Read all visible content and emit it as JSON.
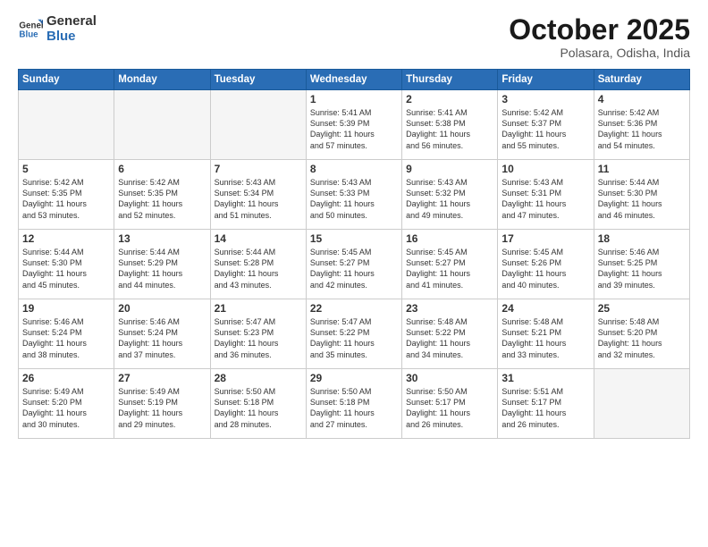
{
  "header": {
    "logo_general": "General",
    "logo_blue": "Blue",
    "month_title": "October 2025",
    "subtitle": "Polasara, Odisha, India"
  },
  "weekdays": [
    "Sunday",
    "Monday",
    "Tuesday",
    "Wednesday",
    "Thursday",
    "Friday",
    "Saturday"
  ],
  "weeks": [
    [
      {
        "day": "",
        "empty": true
      },
      {
        "day": "",
        "empty": true
      },
      {
        "day": "",
        "empty": true
      },
      {
        "day": "1",
        "line1": "Sunrise: 5:41 AM",
        "line2": "Sunset: 5:39 PM",
        "line3": "Daylight: 11 hours",
        "line4": "and 57 minutes."
      },
      {
        "day": "2",
        "line1": "Sunrise: 5:41 AM",
        "line2": "Sunset: 5:38 PM",
        "line3": "Daylight: 11 hours",
        "line4": "and 56 minutes."
      },
      {
        "day": "3",
        "line1": "Sunrise: 5:42 AM",
        "line2": "Sunset: 5:37 PM",
        "line3": "Daylight: 11 hours",
        "line4": "and 55 minutes."
      },
      {
        "day": "4",
        "line1": "Sunrise: 5:42 AM",
        "line2": "Sunset: 5:36 PM",
        "line3": "Daylight: 11 hours",
        "line4": "and 54 minutes."
      }
    ],
    [
      {
        "day": "5",
        "line1": "Sunrise: 5:42 AM",
        "line2": "Sunset: 5:35 PM",
        "line3": "Daylight: 11 hours",
        "line4": "and 53 minutes."
      },
      {
        "day": "6",
        "line1": "Sunrise: 5:42 AM",
        "line2": "Sunset: 5:35 PM",
        "line3": "Daylight: 11 hours",
        "line4": "and 52 minutes."
      },
      {
        "day": "7",
        "line1": "Sunrise: 5:43 AM",
        "line2": "Sunset: 5:34 PM",
        "line3": "Daylight: 11 hours",
        "line4": "and 51 minutes."
      },
      {
        "day": "8",
        "line1": "Sunrise: 5:43 AM",
        "line2": "Sunset: 5:33 PM",
        "line3": "Daylight: 11 hours",
        "line4": "and 50 minutes."
      },
      {
        "day": "9",
        "line1": "Sunrise: 5:43 AM",
        "line2": "Sunset: 5:32 PM",
        "line3": "Daylight: 11 hours",
        "line4": "and 49 minutes."
      },
      {
        "day": "10",
        "line1": "Sunrise: 5:43 AM",
        "line2": "Sunset: 5:31 PM",
        "line3": "Daylight: 11 hours",
        "line4": "and 47 minutes."
      },
      {
        "day": "11",
        "line1": "Sunrise: 5:44 AM",
        "line2": "Sunset: 5:30 PM",
        "line3": "Daylight: 11 hours",
        "line4": "and 46 minutes."
      }
    ],
    [
      {
        "day": "12",
        "line1": "Sunrise: 5:44 AM",
        "line2": "Sunset: 5:30 PM",
        "line3": "Daylight: 11 hours",
        "line4": "and 45 minutes."
      },
      {
        "day": "13",
        "line1": "Sunrise: 5:44 AM",
        "line2": "Sunset: 5:29 PM",
        "line3": "Daylight: 11 hours",
        "line4": "and 44 minutes."
      },
      {
        "day": "14",
        "line1": "Sunrise: 5:44 AM",
        "line2": "Sunset: 5:28 PM",
        "line3": "Daylight: 11 hours",
        "line4": "and 43 minutes."
      },
      {
        "day": "15",
        "line1": "Sunrise: 5:45 AM",
        "line2": "Sunset: 5:27 PM",
        "line3": "Daylight: 11 hours",
        "line4": "and 42 minutes."
      },
      {
        "day": "16",
        "line1": "Sunrise: 5:45 AM",
        "line2": "Sunset: 5:27 PM",
        "line3": "Daylight: 11 hours",
        "line4": "and 41 minutes."
      },
      {
        "day": "17",
        "line1": "Sunrise: 5:45 AM",
        "line2": "Sunset: 5:26 PM",
        "line3": "Daylight: 11 hours",
        "line4": "and 40 minutes."
      },
      {
        "day": "18",
        "line1": "Sunrise: 5:46 AM",
        "line2": "Sunset: 5:25 PM",
        "line3": "Daylight: 11 hours",
        "line4": "and 39 minutes."
      }
    ],
    [
      {
        "day": "19",
        "line1": "Sunrise: 5:46 AM",
        "line2": "Sunset: 5:24 PM",
        "line3": "Daylight: 11 hours",
        "line4": "and 38 minutes."
      },
      {
        "day": "20",
        "line1": "Sunrise: 5:46 AM",
        "line2": "Sunset: 5:24 PM",
        "line3": "Daylight: 11 hours",
        "line4": "and 37 minutes."
      },
      {
        "day": "21",
        "line1": "Sunrise: 5:47 AM",
        "line2": "Sunset: 5:23 PM",
        "line3": "Daylight: 11 hours",
        "line4": "and 36 minutes."
      },
      {
        "day": "22",
        "line1": "Sunrise: 5:47 AM",
        "line2": "Sunset: 5:22 PM",
        "line3": "Daylight: 11 hours",
        "line4": "and 35 minutes."
      },
      {
        "day": "23",
        "line1": "Sunrise: 5:48 AM",
        "line2": "Sunset: 5:22 PM",
        "line3": "Daylight: 11 hours",
        "line4": "and 34 minutes."
      },
      {
        "day": "24",
        "line1": "Sunrise: 5:48 AM",
        "line2": "Sunset: 5:21 PM",
        "line3": "Daylight: 11 hours",
        "line4": "and 33 minutes."
      },
      {
        "day": "25",
        "line1": "Sunrise: 5:48 AM",
        "line2": "Sunset: 5:20 PM",
        "line3": "Daylight: 11 hours",
        "line4": "and 32 minutes."
      }
    ],
    [
      {
        "day": "26",
        "line1": "Sunrise: 5:49 AM",
        "line2": "Sunset: 5:20 PM",
        "line3": "Daylight: 11 hours",
        "line4": "and 30 minutes."
      },
      {
        "day": "27",
        "line1": "Sunrise: 5:49 AM",
        "line2": "Sunset: 5:19 PM",
        "line3": "Daylight: 11 hours",
        "line4": "and 29 minutes."
      },
      {
        "day": "28",
        "line1": "Sunrise: 5:50 AM",
        "line2": "Sunset: 5:18 PM",
        "line3": "Daylight: 11 hours",
        "line4": "and 28 minutes."
      },
      {
        "day": "29",
        "line1": "Sunrise: 5:50 AM",
        "line2": "Sunset: 5:18 PM",
        "line3": "Daylight: 11 hours",
        "line4": "and 27 minutes."
      },
      {
        "day": "30",
        "line1": "Sunrise: 5:50 AM",
        "line2": "Sunset: 5:17 PM",
        "line3": "Daylight: 11 hours",
        "line4": "and 26 minutes."
      },
      {
        "day": "31",
        "line1": "Sunrise: 5:51 AM",
        "line2": "Sunset: 5:17 PM",
        "line3": "Daylight: 11 hours",
        "line4": "and 26 minutes."
      },
      {
        "day": "",
        "empty": true
      }
    ]
  ]
}
